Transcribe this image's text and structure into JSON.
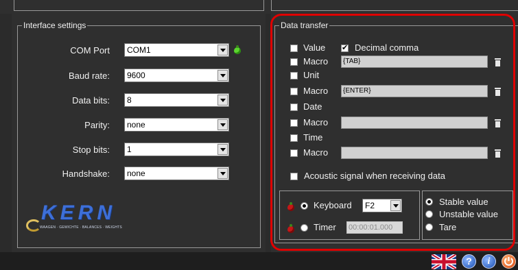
{
  "interface": {
    "title": "Interface settings",
    "rows": [
      {
        "label": "COM Port",
        "value": "COM1"
      },
      {
        "label": "Baud rate:",
        "value": "9600"
      },
      {
        "label": "Data bits:",
        "value": "8"
      },
      {
        "label": "Parity:",
        "value": "none"
      },
      {
        "label": "Stop bits:",
        "value": "1"
      },
      {
        "label": "Handshake:",
        "value": "none"
      }
    ],
    "status_color": "#5cd62e"
  },
  "logo": {
    "name": "KERN",
    "tagline": "WAAGEN · GEWICHTE · BALANCES · WEIGHTS",
    "color": "#3d6fd8"
  },
  "transfer": {
    "title": "Data transfer",
    "value_label": "Value",
    "value_checked": false,
    "decimal_label": "Decimal comma",
    "decimal_checked": true,
    "macro_label": "Macro",
    "macro1": "{TAB}",
    "unit_label": "Unit",
    "macro2": "{ENTER}",
    "date_label": "Date",
    "macro3": "",
    "time_label": "Time",
    "macro4": "",
    "acoustic_label": "Acoustic signal when receiving data",
    "keyboard_label": "Keyboard",
    "keyboard_value": "F2",
    "timer_label": "Timer",
    "timer_value": "00:00:01.000",
    "stable_label": "Stable value",
    "unstable_label": "Unstable value",
    "tare_label": "Tare"
  },
  "footer": {
    "icons": [
      "uk-flag-icon",
      "help-icon",
      "info-icon",
      "power-icon"
    ]
  },
  "highlight_color": "#e00000"
}
